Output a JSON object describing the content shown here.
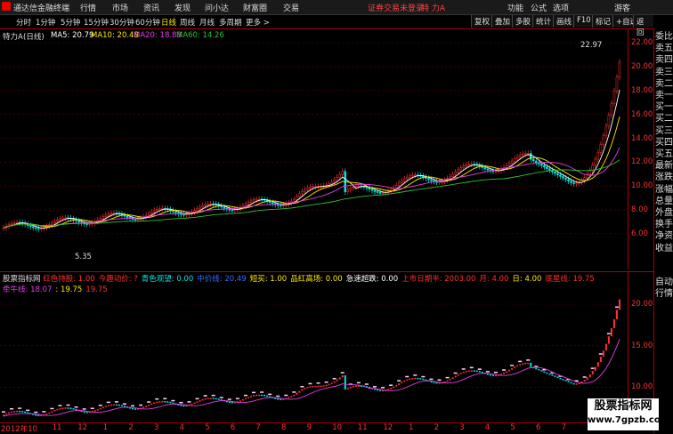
{
  "topbar": {
    "app_title": "通达信金融终端",
    "menus": [
      "行情",
      "市场",
      "资讯",
      "发现",
      "问小达",
      "财富圈",
      "交易"
    ],
    "notice": "证券交易未登录",
    "stock_name": "特 力A",
    "right_menus": [
      "功能",
      "公式",
      "选项",
      "游客"
    ]
  },
  "tabs": [
    "分时",
    "1分钟",
    "5分钟",
    "15分钟",
    "30分钟",
    "60分钟",
    "日线",
    "周线",
    "月线",
    "多周期",
    "更多 >"
  ],
  "active_tab": "日线",
  "toolbar_buttons": [
    "复权",
    "叠加",
    "多股",
    "统计",
    "画线",
    "F10",
    "标记",
    "+自选",
    "返回"
  ],
  "right_column": [
    "委比",
    "卖五",
    "卖四",
    "卖三",
    "卖二",
    "卖一",
    "买一",
    "买二",
    "买三",
    "买四",
    "买五",
    "最新",
    "涨跌",
    "涨幅",
    "总量",
    "外盘",
    "换手",
    "净资",
    "收益",
    "自动",
    "行情"
  ],
  "main_legend": {
    "name": "特力A",
    "period": "(日线)",
    "ma5": "MA5: 20.79",
    "ma10": "MA10: 20.48",
    "ma20": "MA20: 18.83",
    "ma60": "MA60: 14.26"
  },
  "main_axis": [
    "22.00",
    "20.00",
    "18.00",
    "16.00",
    "14.00",
    "12.00",
    "10.00",
    "8.00",
    "6.00"
  ],
  "annotations": {
    "high": "22.97",
    "low": "5.35"
  },
  "sub_legend": {
    "title": "股票指标网",
    "items": [
      {
        "text": "红色持股: 1.00",
        "color": "#ff3030"
      },
      {
        "text": "今趣动价: ?",
        "color": "#ff3030"
      },
      {
        "text": "青色观望: 0.00",
        "color": "#00e5e5"
      },
      {
        "text": "中价线: 20.49",
        "color": "#3a6bff"
      },
      {
        "text": "短买: 1.00",
        "color": "#ffea00"
      },
      {
        "text": "品红高场: 0.00",
        "color": "#ffea00"
      },
      {
        "text": "急速超跌: 0.00",
        "color": "#ffffff"
      },
      {
        "text": "上市日期半: 2003.00",
        "color": "#ff3030"
      },
      {
        "text": "月: 4.00",
        "color": "#ff3030"
      },
      {
        "text": "日: 4.00",
        "color": "#ffea00"
      },
      {
        "text": "底星线: 19.75",
        "color": "#ff3030"
      },
      {
        "text": "牵牛线: 18.07",
        "color": "#e040e0"
      },
      {
        "text": ": 19.75",
        "color": "#ffea00"
      },
      {
        "text": "19.75",
        "color": "#ff3030"
      }
    ]
  },
  "sub_axis": [
    "20.00",
    "15.00",
    "10.00"
  ],
  "x_axis": [
    "2012年10",
    "11",
    "12",
    "1",
    "2",
    "3",
    "4",
    "5",
    "6",
    "7",
    "8",
    "9",
    "10",
    "11",
    "12",
    "1",
    "2",
    "3",
    "4",
    "5",
    "6",
    "7",
    "8",
    "9"
  ],
  "watermark": {
    "line1": "股票指标网",
    "line2": "www.7gpzb.com"
  },
  "colors": {
    "up": "#ff3030",
    "down": "#00e5e5",
    "ma5": "#ffffff",
    "ma10": "#ffea00",
    "ma20": "#e040e0",
    "ma60": "#30c030"
  }
}
